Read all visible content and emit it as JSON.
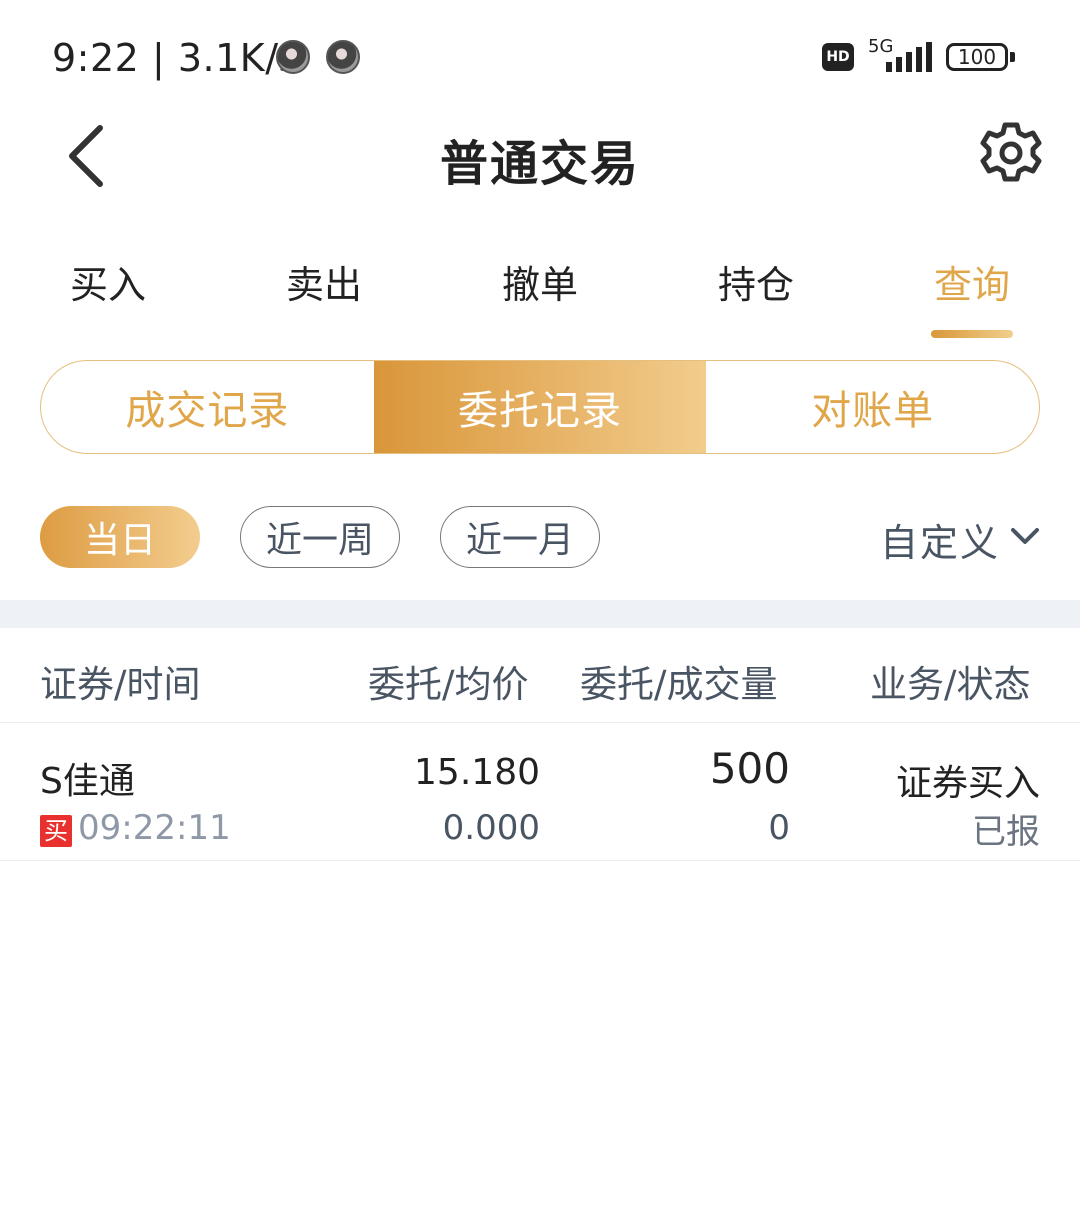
{
  "status_bar": {
    "time": "9:22",
    "separator": "|",
    "speed": "3.1K/s",
    "hd": "HD",
    "network": "5G",
    "battery": "100"
  },
  "header": {
    "title": "普通交易"
  },
  "main_tabs": [
    {
      "label": "买入"
    },
    {
      "label": "卖出"
    },
    {
      "label": "撤单"
    },
    {
      "label": "持仓"
    },
    {
      "label": "查询",
      "active": true
    }
  ],
  "segments": [
    {
      "label": "成交记录"
    },
    {
      "label": "委托记录",
      "active": true
    },
    {
      "label": "对账单"
    }
  ],
  "periods": [
    {
      "label": "当日",
      "active": true
    },
    {
      "label": "近一周"
    },
    {
      "label": "近一月"
    }
  ],
  "custom_label": "自定义",
  "table": {
    "headers": [
      "证券/时间",
      "委托/均价",
      "委托/成交量",
      "业务/状态"
    ],
    "rows": [
      {
        "name": "S佳通",
        "side_tag": "买",
        "time": "09:22:11",
        "order_price": "15.180",
        "avg_price": "0.000",
        "order_qty": "500",
        "filled_qty": "0",
        "business": "证券买入",
        "state": "已报"
      }
    ]
  },
  "colors": {
    "accent": "#e0a64a",
    "buy_tag": "#e8312e",
    "band": "#eef1f6"
  }
}
